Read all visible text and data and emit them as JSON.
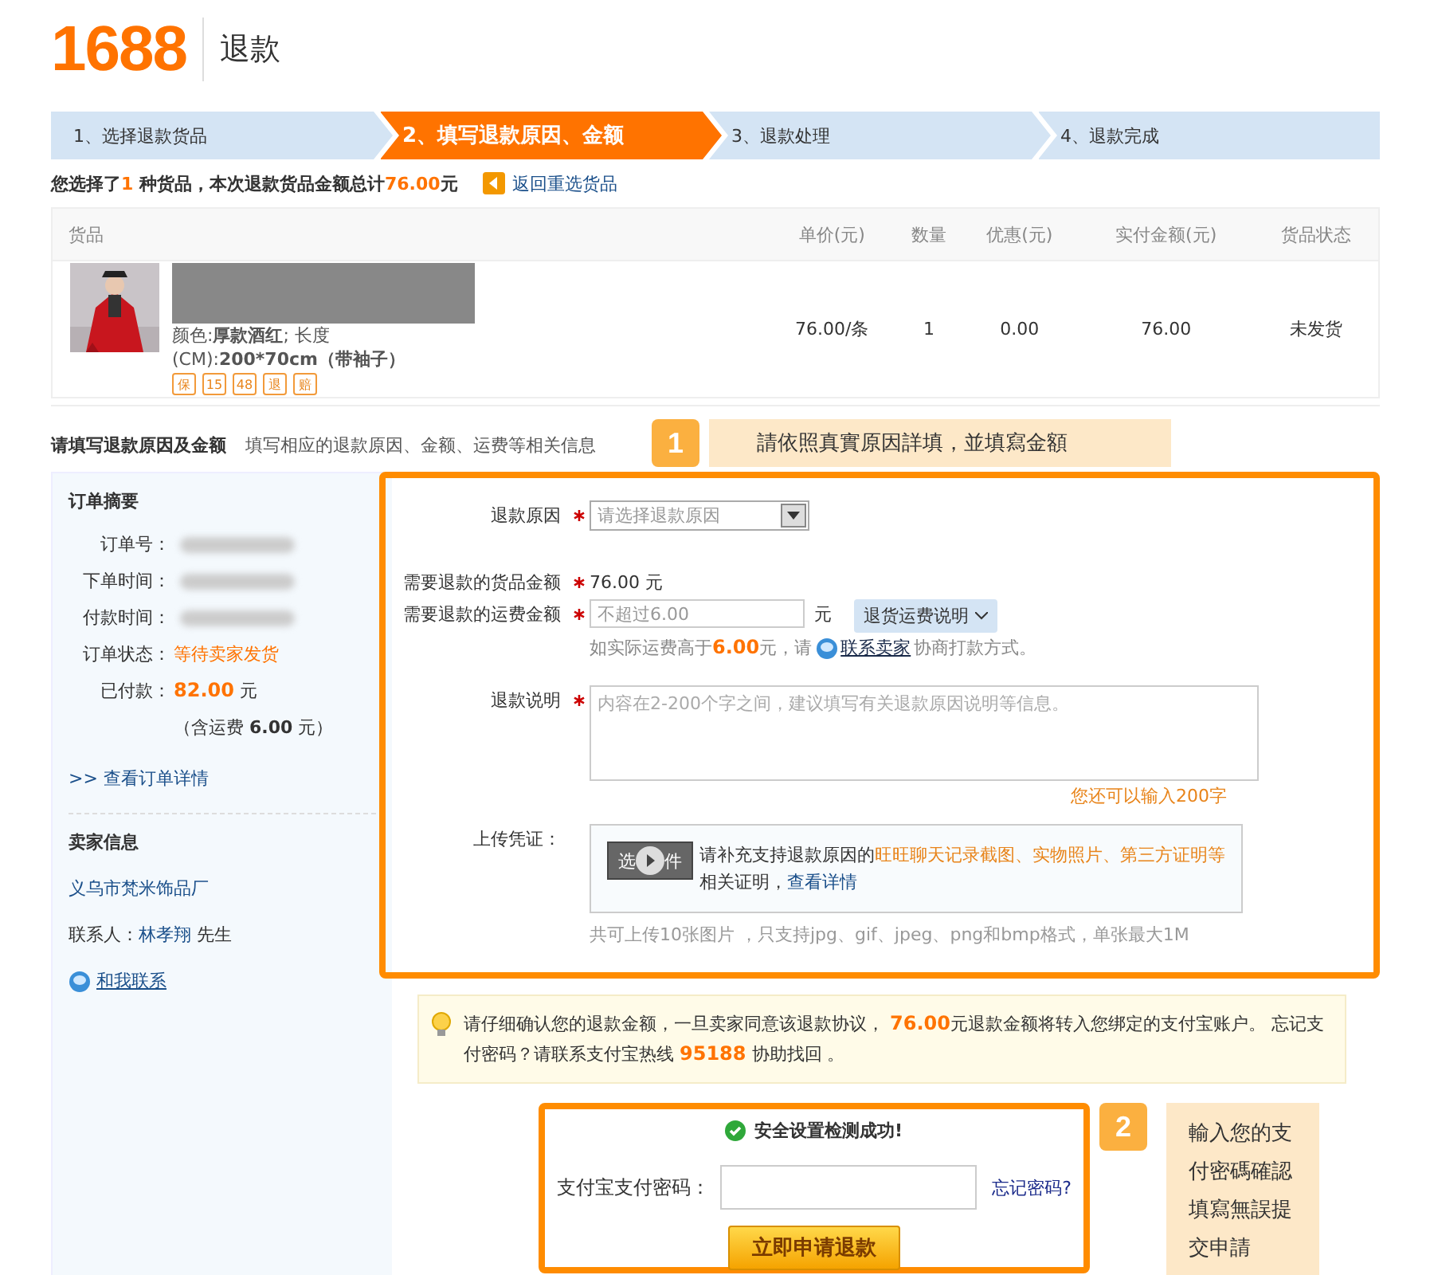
{
  "header": {
    "logo": "1688",
    "title": "退款"
  },
  "steps": [
    {
      "label": "1、选择退款货品",
      "selected": false
    },
    {
      "label": "2、填写退款原因、金额",
      "selected": true
    },
    {
      "label": "3、退款处理",
      "selected": false
    },
    {
      "label": "4、退款完成",
      "selected": false
    }
  ],
  "summary": {
    "prefix": "您选择了",
    "count": "1",
    "middle": " 种货品，本次退款货品金额总计",
    "amount": "76.00",
    "unit": "元",
    "back_link": "返回重选货品"
  },
  "table": {
    "columns": [
      "货品",
      "单价(元)",
      "数量",
      "优惠(元)",
      "实付金额(元)",
      "货品状态"
    ],
    "rows": [
      {
        "spec_line1": "颜色:**厚款酒红**;        长度",
        "spec_line2": "(CM):**200*70cm（带袖子）**",
        "service_badges": [
          "保",
          "15",
          "48",
          "退",
          "赔"
        ],
        "unit_price": "76.00/条",
        "quantity": "1",
        "discount": "0.00",
        "paid": "76.00",
        "status": "未发货"
      }
    ]
  },
  "section": {
    "title": "请填写退款原因及金额",
    "subtitle": "填写相应的退款原因、金额、运费等相关信息"
  },
  "callout_1": {
    "number": "1",
    "text": "請依照真實原因詳填，並填寫金額"
  },
  "order_summary": {
    "title": "订单摘要",
    "fields": [
      {
        "label": "订单号：",
        "kind": "redacted"
      },
      {
        "label": "下单时间：",
        "kind": "redacted"
      },
      {
        "label": "付款时间：",
        "kind": "redacted"
      },
      {
        "label": "订单状态：",
        "kind": "status",
        "value": "等待卖家发货"
      },
      {
        "label": "已付款：",
        "kind": "amount",
        "value": "82.00",
        "unit": "元"
      }
    ],
    "shipping_note": "（含运费 **6.00** 元）",
    "details_link": ">> 查看订单详情"
  },
  "seller": {
    "title": "卖家信息",
    "name": "义乌市梵米饰品厂",
    "contact_label": "联系人：",
    "contact_name": "林孝翔",
    "contact_suffix": "先生",
    "chat_link": "和我联系"
  },
  "form": {
    "reason": {
      "label": "退款原因",
      "required": true,
      "placeholder": "请选择退款原因"
    },
    "goods_amount": {
      "label": "需要退款的货品金额",
      "required": true,
      "value": "76.00",
      "unit": "元"
    },
    "shipping_amount": {
      "label": "需要退款的运费金额",
      "required": true,
      "placeholder": "不超过6.00",
      "unit": "元",
      "dropdown": "退货运费说明"
    },
    "shipping_hint": {
      "prefix": "如实际运费高于",
      "amount": "6.00",
      "middle": "元，请",
      "link": "联系卖家",
      "suffix": "协商打款方式。"
    },
    "description": {
      "label": "退款说明",
      "required": true,
      "placeholder": "内容在2-200个字之间，建议填写有关退款原因说明等信息。",
      "remaining": "您还可以输入200字"
    },
    "upload": {
      "label": "上传凭证：",
      "button_left": "选",
      "button_right": "件",
      "hint_prefix": "请补充支持退款原因的",
      "hint_highlight": "旺旺聊天记录截图、实物照片、第三方证明等",
      "hint_suffix": "相关证明，",
      "details_link": "查看详情",
      "note": "共可上传10张图片 ，只支持jpg、gif、jpeg、png和bmp格式，单张最大1M"
    }
  },
  "notice": {
    "prefix": "请仔细确认您的退款金额，一旦卖家同意该退款协议，",
    "amount": "76.00",
    "middle": "元退款金额将转入您绑定的支付宝账户。 忘记支付密码？请联系支付宝热线",
    "hotline": "95188",
    "suffix": "协助找回 。"
  },
  "payment": {
    "status": "安全设置检测成功!",
    "password_label": "支付宝支付密码：",
    "forgot_link": "忘记密码?",
    "submit": "立即申请退款"
  },
  "callout_2": {
    "number": "2",
    "text": "輸入您的支付密碼確認填寫無誤提交申請"
  }
}
